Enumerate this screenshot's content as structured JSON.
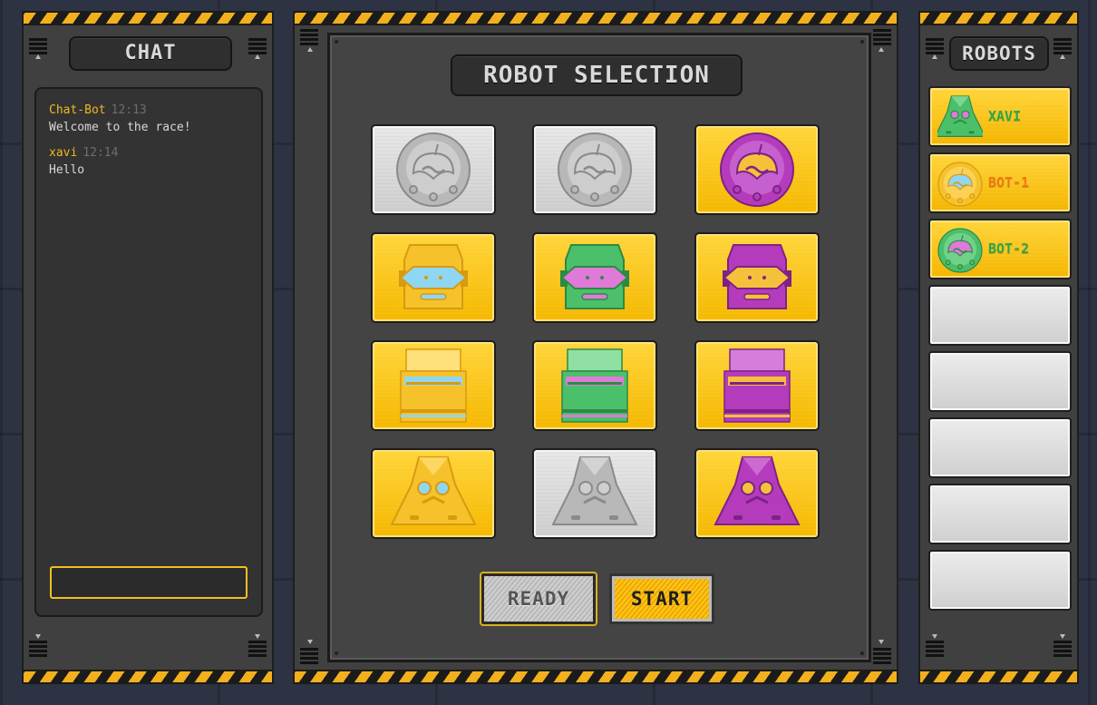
{
  "colors": {
    "hazard_yellow": "#f2b01e",
    "panel_gray": "#404040",
    "card_yellow": "#f7c21c",
    "card_silver": "#d9d9d9",
    "chat_name": "#f0b820",
    "robot_green": "#4cc06a",
    "robot_purple": "#b03ab8",
    "robot_orange": "#f09a1a",
    "robot_blue": "#7fd0f0"
  },
  "chat": {
    "title": "CHAT",
    "messages": [
      {
        "author": "Chat-Bot",
        "time": "12:13",
        "text": "Welcome to the race!"
      },
      {
        "author": "xavi",
        "time": "12:14",
        "text": "Hello"
      }
    ],
    "input_value": ""
  },
  "selection": {
    "title": "ROBOT SELECTION",
    "robots": [
      {
        "shape": "round",
        "color": "gray",
        "state": "taken"
      },
      {
        "shape": "round",
        "color": "gray",
        "state": "taken"
      },
      {
        "shape": "round",
        "color": "purple",
        "state": "available"
      },
      {
        "shape": "head",
        "color": "yellow",
        "state": "available"
      },
      {
        "shape": "head",
        "color": "green",
        "state": "available"
      },
      {
        "shape": "head",
        "color": "purple",
        "state": "available"
      },
      {
        "shape": "box",
        "color": "yellow",
        "state": "available"
      },
      {
        "shape": "box",
        "color": "green",
        "state": "available"
      },
      {
        "shape": "box",
        "color": "purple",
        "state": "available"
      },
      {
        "shape": "pyramid",
        "color": "yellow",
        "state": "available"
      },
      {
        "shape": "pyramid",
        "color": "gray",
        "state": "taken"
      },
      {
        "shape": "pyramid",
        "color": "purple",
        "state": "available"
      }
    ],
    "ready_label": "READY",
    "start_label": "START"
  },
  "robots_list": {
    "title": "ROBOTS",
    "players": [
      {
        "name": "XAVI",
        "robot_shape": "pyramid",
        "robot_color": "green",
        "name_color": "#2da84a"
      },
      {
        "name": "BOT-1",
        "robot_shape": "round",
        "robot_color": "yellow",
        "name_color": "#f07a10"
      },
      {
        "name": "BOT-2",
        "robot_shape": "round",
        "robot_color": "green",
        "name_color": "#2da84a"
      }
    ],
    "empty_slots": 5
  }
}
